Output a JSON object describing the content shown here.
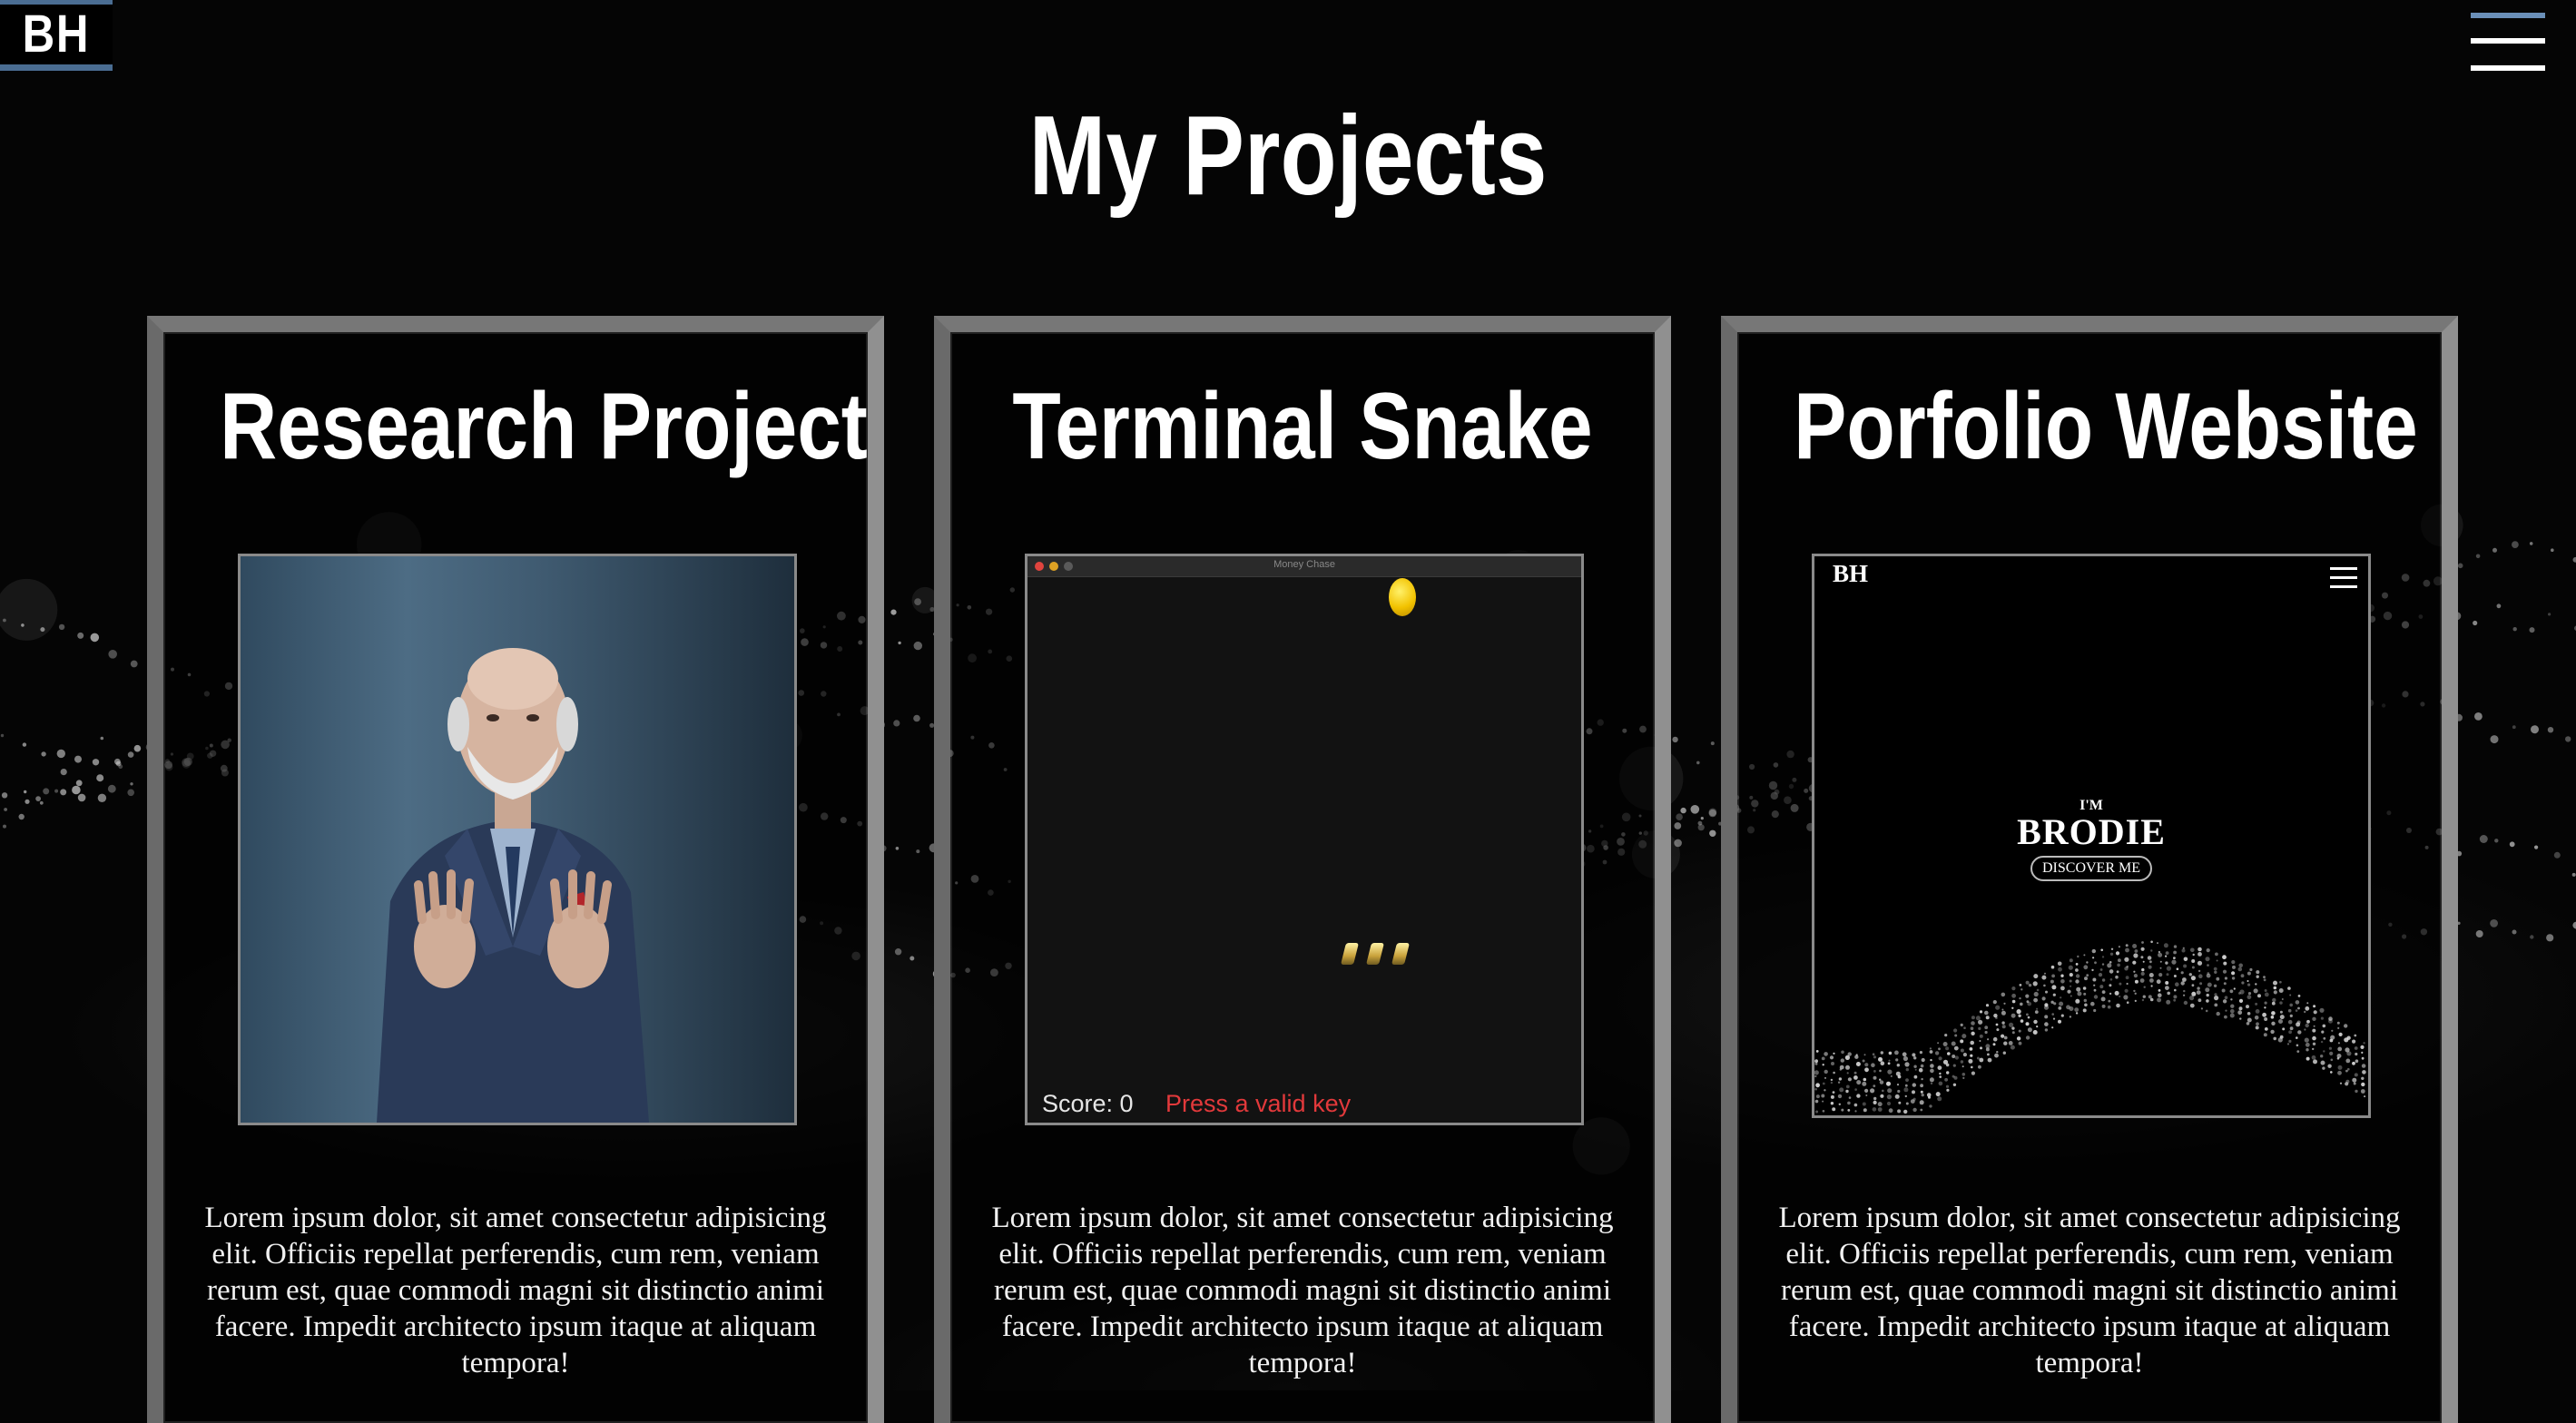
{
  "header": {
    "logo": "BH",
    "menu_icon": "hamburger-menu-icon"
  },
  "page": {
    "title": "My Projects"
  },
  "projects": [
    {
      "title": "Research Project",
      "image_icon": "portrait-photo",
      "description": "Lorem ipsum dolor, sit amet consectetur adipisicing elit. Officiis repellat perferendis, cum rem, veniam rerum est, quae commodi magni sit distinctio animi facere. Impedit architecto ipsum itaque at aliquam tempora!"
    },
    {
      "title": "Terminal Snake",
      "image_icon": "game-screenshot",
      "game": {
        "window_title": "Money Chase",
        "score": "Score: 0",
        "message": "Press a valid key"
      },
      "description": "Lorem ipsum dolor, sit amet consectetur adipisicing elit. Officiis repellat perferendis, cum rem, veniam rerum est, quae commodi magni sit distinctio animi facere. Impedit architecto ipsum itaque at aliquam tempora!"
    },
    {
      "title": "Porfolio Website",
      "image_icon": "website-screenshot",
      "site": {
        "logo": "BH",
        "intro": "I'M",
        "name": "BRODIE",
        "button": "DISCOVER ME"
      },
      "description": "Lorem ipsum dolor, sit amet consectetur adipisicing elit. Officiis repellat perferendis, cum rem, veniam rerum est, quae commodi magni sit distinctio animi facere. Impedit architecto ipsum itaque at aliquam tempora!"
    }
  ],
  "colors": {
    "background": "#050505",
    "accent": "#4a6d92",
    "card_border": "#777777",
    "error_text": "#e2393b"
  }
}
